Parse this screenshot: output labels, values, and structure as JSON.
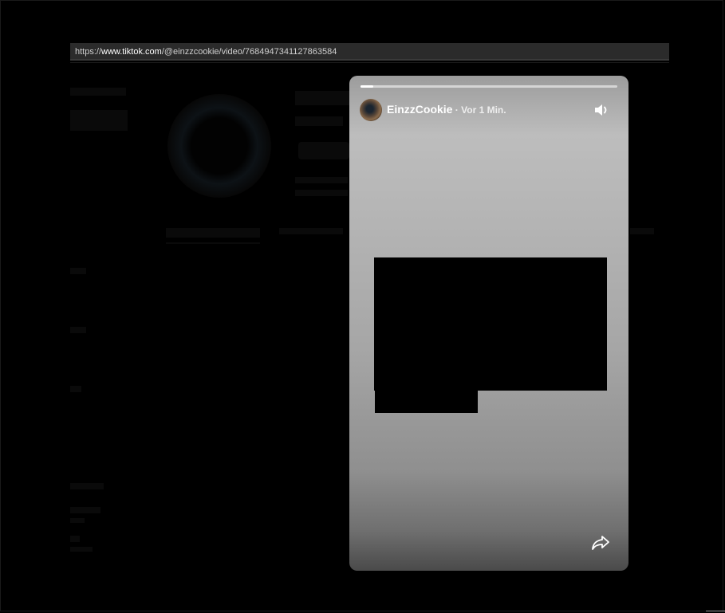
{
  "browser": {
    "url_prefix": "https://",
    "url_host": "www.tiktok.com",
    "url_path": "/@einzzcookie/video/7684947341127863584"
  },
  "story": {
    "username": "EinzzCookie",
    "time": " · Vor 1 Min.",
    "progress_fraction": 0.05,
    "icons": {
      "sound": "speaker-icon",
      "share": "share-arrow-icon"
    }
  }
}
